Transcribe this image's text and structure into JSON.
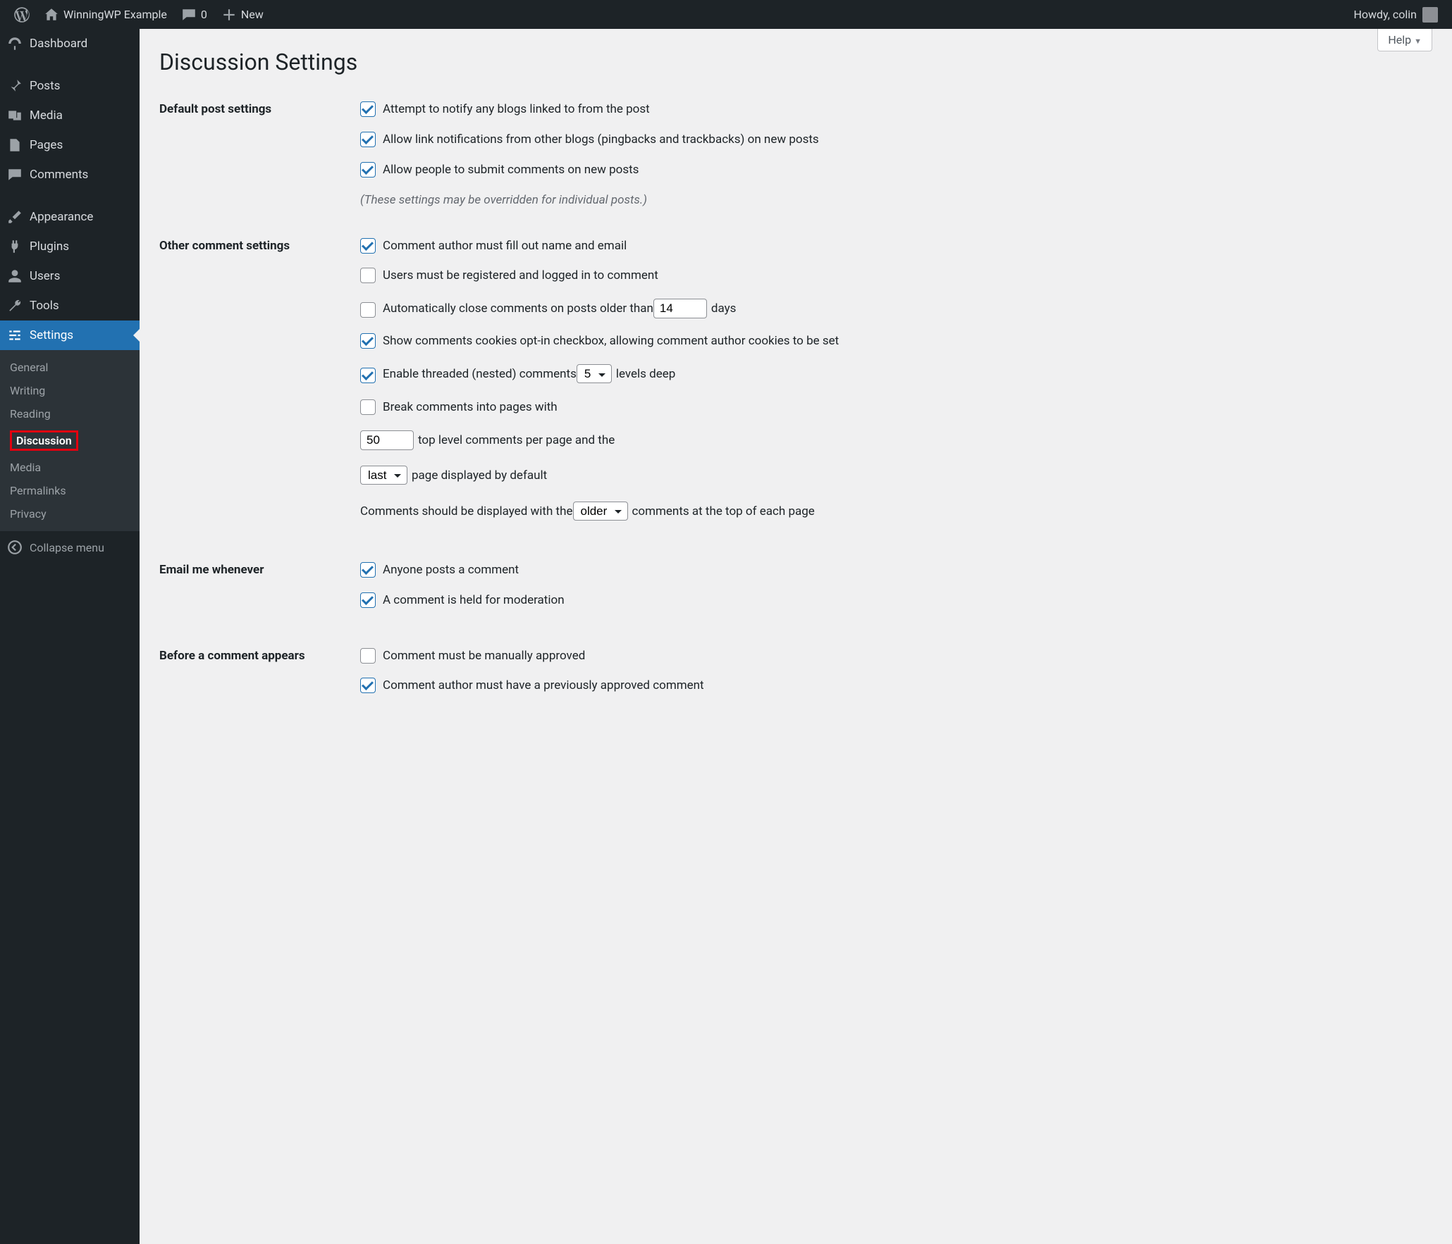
{
  "adminbar": {
    "site_name": "WinningWP Example",
    "comments_count": "0",
    "new_label": "New",
    "howdy": "Howdy, colin"
  },
  "sidebar": {
    "dashboard": "Dashboard",
    "posts": "Posts",
    "media": "Media",
    "pages": "Pages",
    "comments": "Comments",
    "appearance": "Appearance",
    "plugins": "Plugins",
    "users": "Users",
    "tools": "Tools",
    "settings": "Settings",
    "submenu": {
      "general": "General",
      "writing": "Writing",
      "reading": "Reading",
      "discussion": "Discussion",
      "media": "Media",
      "permalinks": "Permalinks",
      "privacy": "Privacy"
    },
    "collapse": "Collapse menu"
  },
  "help": {
    "label": "Help"
  },
  "page": {
    "title": "Discussion Settings",
    "sections": {
      "default_post": {
        "heading": "Default post settings",
        "opt1": "Attempt to notify any blogs linked to from the post",
        "opt2": "Allow link notifications from other blogs (pingbacks and trackbacks) on new posts",
        "opt3": "Allow people to submit comments on new posts",
        "note": "(These settings may be overridden for individual posts.)"
      },
      "other": {
        "heading": "Other comment settings",
        "name_email": "Comment author must fill out name and email",
        "registered": "Users must be registered and logged in to comment",
        "autoclose_pre": "Automatically close comments on posts older than ",
        "autoclose_days": "14",
        "autoclose_post": " days",
        "cookies": "Show comments cookies opt-in checkbox, allowing comment author cookies to be set",
        "threaded_pre": "Enable threaded (nested) comments ",
        "threaded_levels": "5",
        "threaded_post": " levels deep",
        "paginate": "Break comments into pages with",
        "per_page": "50",
        "per_page_post": " top level comments per page and the ",
        "page_default": "last",
        "page_default_post": " page displayed by default",
        "order_pre": "Comments should be displayed with the ",
        "order": "older",
        "order_post": " comments at the top of each page"
      },
      "email": {
        "heading": "Email me whenever",
        "opt1": "Anyone posts a comment",
        "opt2": "A comment is held for moderation"
      },
      "before": {
        "heading": "Before a comment appears",
        "opt1": "Comment must be manually approved",
        "opt2": "Comment author must have a previously approved comment"
      }
    }
  }
}
